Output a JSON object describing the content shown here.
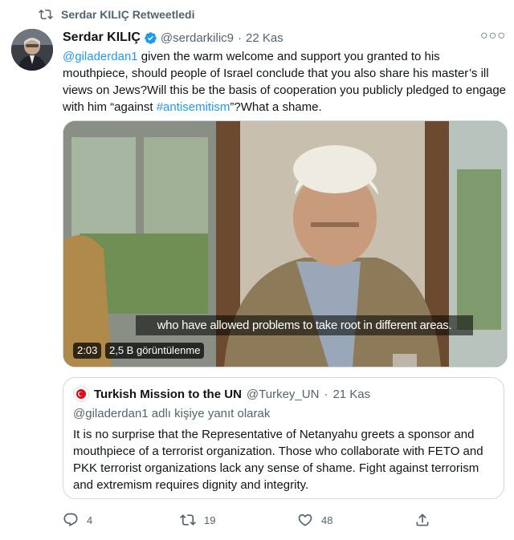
{
  "retweet_context": {
    "label": "Serdar KILIÇ Retweetledi",
    "icon": "retweet-icon"
  },
  "tweet": {
    "author_name": "Serdar KILIÇ",
    "handle": "@serdarkilic9",
    "separator": "·",
    "date": "22 Kas",
    "more_icon": "more-options-icon",
    "text_mention": "@giladerdan1",
    "text_part1": " given the warm welcome and support you granted to his mouthpiece, should people of Israel conclude that you also share his master’s ill views on Jews?Will this be the basis of cooperation you publicly pledged to engage with him “against ",
    "text_hashtag": "#antisemitism",
    "text_part2": "”?What a shame."
  },
  "media": {
    "subtitle": "who have allowed problems to take root in different areas.",
    "duration": "2:03",
    "views": "2,5 B görüntülenme"
  },
  "quoted_tweet": {
    "author_name": "Turkish Mission to the UN",
    "handle": "@Turkey_UN",
    "separator": "·",
    "date": "21 Kas",
    "reply_context": "@giladerdan1 adlı kişiye yanıt olarak",
    "text": "It is no surprise that the Representative of Netanyahu greets a sponsor and mouthpiece of a terrorist organization. Those who collaborate with FETO and PKK terrorist organizations lack any sense of shame. Fight against terrorism and extremism requires dignity and integrity."
  },
  "actions": {
    "reply_count": "4",
    "retweet_count": "19",
    "like_count": "48",
    "share_icon": "share-icon"
  },
  "colors": {
    "accent": "#1d9bf0",
    "muted": "#536471",
    "border": "#cfd9de",
    "text": "#0f1419"
  }
}
